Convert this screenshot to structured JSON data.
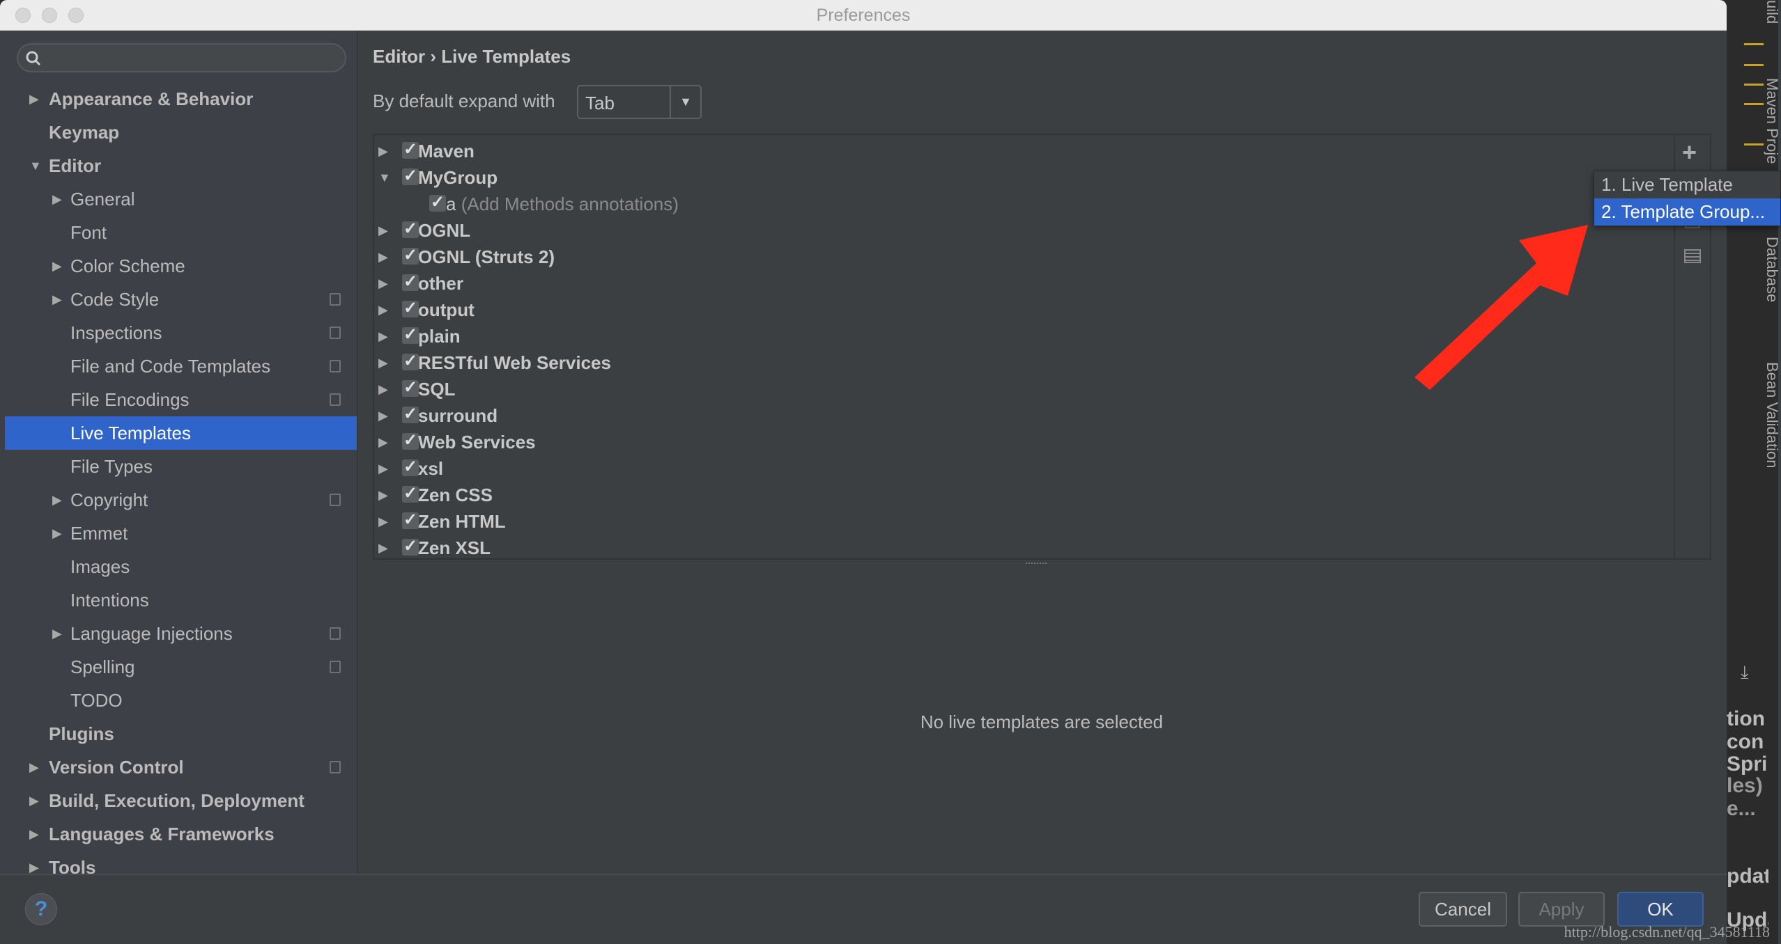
{
  "window": {
    "title": "Preferences"
  },
  "search": {
    "placeholder": ""
  },
  "sidebar": {
    "items": [
      {
        "label": "Appearance & Behavior",
        "level": 0,
        "arrow": "right",
        "bold": true
      },
      {
        "label": "Keymap",
        "level": 0,
        "arrow": "",
        "bold": true
      },
      {
        "label": "Editor",
        "level": 0,
        "arrow": "down",
        "bold": true
      },
      {
        "label": "General",
        "level": 1,
        "arrow": "right"
      },
      {
        "label": "Font",
        "level": 1,
        "arrow": ""
      },
      {
        "label": "Color Scheme",
        "level": 1,
        "arrow": "right"
      },
      {
        "label": "Code Style",
        "level": 1,
        "arrow": "right",
        "copy": true
      },
      {
        "label": "Inspections",
        "level": 1,
        "arrow": "",
        "copy": true
      },
      {
        "label": "File and Code Templates",
        "level": 1,
        "arrow": "",
        "copy": true
      },
      {
        "label": "File Encodings",
        "level": 1,
        "arrow": "",
        "copy": true
      },
      {
        "label": "Live Templates",
        "level": 1,
        "arrow": "",
        "selected": true
      },
      {
        "label": "File Types",
        "level": 1,
        "arrow": ""
      },
      {
        "label": "Copyright",
        "level": 1,
        "arrow": "right",
        "copy": true
      },
      {
        "label": "Emmet",
        "level": 1,
        "arrow": "right"
      },
      {
        "label": "Images",
        "level": 1,
        "arrow": ""
      },
      {
        "label": "Intentions",
        "level": 1,
        "arrow": ""
      },
      {
        "label": "Language Injections",
        "level": 1,
        "arrow": "right",
        "copy": true
      },
      {
        "label": "Spelling",
        "level": 1,
        "arrow": "",
        "copy": true
      },
      {
        "label": "TODO",
        "level": 1,
        "arrow": ""
      },
      {
        "label": "Plugins",
        "level": 0,
        "arrow": "",
        "bold": true
      },
      {
        "label": "Version Control",
        "level": 0,
        "arrow": "right",
        "bold": true,
        "copy": true
      },
      {
        "label": "Build, Execution, Deployment",
        "level": 0,
        "arrow": "right",
        "bold": true
      },
      {
        "label": "Languages & Frameworks",
        "level": 0,
        "arrow": "right",
        "bold": true
      },
      {
        "label": "Tools",
        "level": 0,
        "arrow": "right",
        "bold": true
      }
    ]
  },
  "main": {
    "breadcrumb": {
      "parent": "Editor",
      "separator": "›",
      "current": "Live Templates"
    },
    "expand": {
      "label": "By default expand with",
      "value": "Tab"
    },
    "groups": [
      {
        "label": "Maven",
        "expanded": false,
        "checked": true
      },
      {
        "label": "MyGroup",
        "expanded": true,
        "checked": true,
        "children": [
          {
            "abbr": "a",
            "desc": "(Add Methods annotations)",
            "checked": true
          }
        ]
      },
      {
        "label": "OGNL",
        "expanded": false,
        "checked": true
      },
      {
        "label": "OGNL (Struts 2)",
        "expanded": false,
        "checked": true
      },
      {
        "label": "other",
        "expanded": false,
        "checked": true
      },
      {
        "label": "output",
        "expanded": false,
        "checked": true
      },
      {
        "label": "plain",
        "expanded": false,
        "checked": true
      },
      {
        "label": "RESTful Web Services",
        "expanded": false,
        "checked": true
      },
      {
        "label": "SQL",
        "expanded": false,
        "checked": true
      },
      {
        "label": "surround",
        "expanded": false,
        "checked": true
      },
      {
        "label": "Web Services",
        "expanded": false,
        "checked": true
      },
      {
        "label": "xsl",
        "expanded": false,
        "checked": true
      },
      {
        "label": "Zen CSS",
        "expanded": false,
        "checked": true
      },
      {
        "label": "Zen HTML",
        "expanded": false,
        "checked": true
      },
      {
        "label": "Zen XSL",
        "expanded": false,
        "checked": true
      }
    ],
    "toolbar": {
      "add": "+"
    },
    "empty_message": "No live templates are selected"
  },
  "popup": {
    "items": [
      "1. Live Template",
      "2. Template Group..."
    ],
    "highlighted": 1
  },
  "buttons": {
    "help": "?",
    "cancel": "Cancel",
    "apply": "Apply",
    "ok": "OK"
  },
  "ide_strip": {
    "tool_windows": [
      "uild",
      "Maven Proje",
      "Database",
      "Bean Validation"
    ],
    "fragments": [
      "tion",
      "con",
      "Sprin",
      "les)",
      "e...",
      "pdate",
      "Upda"
    ]
  },
  "watermark": "http://blog.csdn.net/qq_34581118",
  "colors": {
    "selection": "#2f65ca",
    "annotation_arrow": "#ff2a1a",
    "ok_button": "#2d4c7c"
  }
}
